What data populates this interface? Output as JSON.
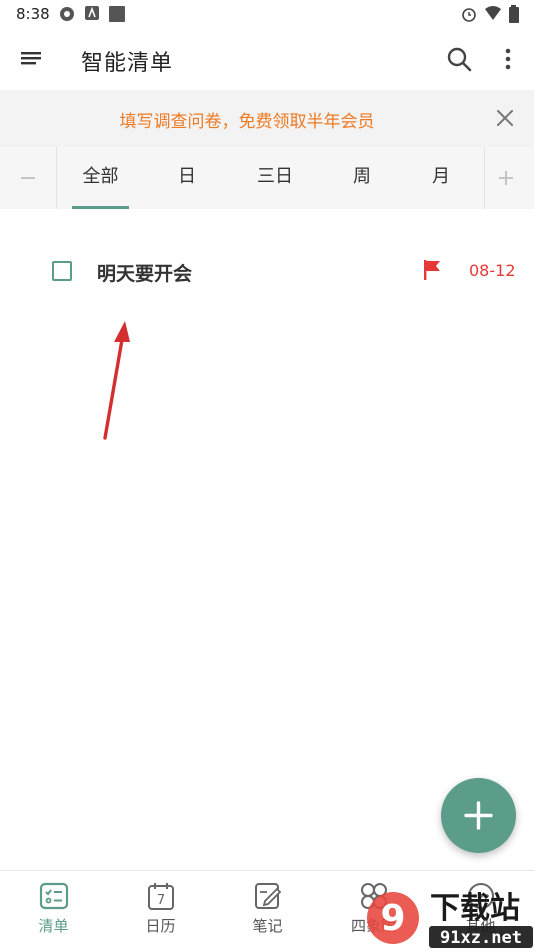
{
  "status_bar": {
    "time": "8:38"
  },
  "app_bar": {
    "title": "智能清单"
  },
  "banner": {
    "text": "填写调查问卷，免费领取半年会员"
  },
  "tabs": [
    {
      "label": "全部",
      "active": true
    },
    {
      "label": "日",
      "active": false
    },
    {
      "label": "三日",
      "active": false
    },
    {
      "label": "周",
      "active": false
    },
    {
      "label": "月",
      "active": false
    }
  ],
  "tasks": [
    {
      "title": "明天要开会",
      "due": "08-12",
      "flag_color": "#e53935",
      "done": false
    }
  ],
  "bottom_nav": [
    {
      "label": "清单",
      "icon": "checklist-icon",
      "active": true
    },
    {
      "label": "日历",
      "icon": "calendar-icon",
      "calendar_day": "7",
      "active": false
    },
    {
      "label": "笔记",
      "icon": "note-icon",
      "active": false
    },
    {
      "label": "四象限",
      "icon": "quadrant-icon",
      "active": false
    },
    {
      "label": "其他",
      "icon": "more-icon",
      "active": false
    }
  ],
  "watermark": {
    "brand": "下载站",
    "url": "91xz.net"
  },
  "colors": {
    "accent": "#5c9c8a",
    "banner_text": "#ee7a21",
    "due": "#e53935",
    "annotation_arrow": "#d32f2f"
  }
}
